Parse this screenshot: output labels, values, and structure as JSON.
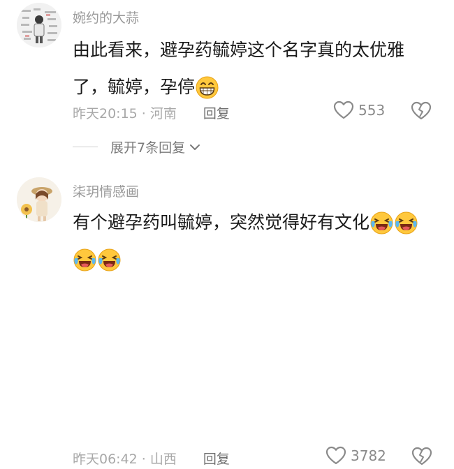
{
  "comments": [
    {
      "username": "婉约的大蒜",
      "text_lines": [
        "由此看来，避孕药毓婷这个名字真的太优雅",
        "了，毓婷，孕停"
      ],
      "emoji_line1": "grin-emoji",
      "time_location": "昨天20:15 · 河南",
      "reply_label": "回复",
      "likes": "553",
      "expand_label": "展开7条回复"
    },
    {
      "username": "柒玥情感画",
      "text_lines": [
        "有个避孕药叫毓婷，突然觉得好有文化"
      ],
      "emoji": "laugh-cry-emoji",
      "time_location": "昨天06:42 · 山西",
      "reply_label": "回复",
      "likes": "3782"
    }
  ],
  "colors": {
    "username": "#9a9a9a",
    "text": "#1a1a1a",
    "meta": "#a8a8a8",
    "icon": "#8a8a8a",
    "emoji_yellow": "#ffc83d"
  }
}
